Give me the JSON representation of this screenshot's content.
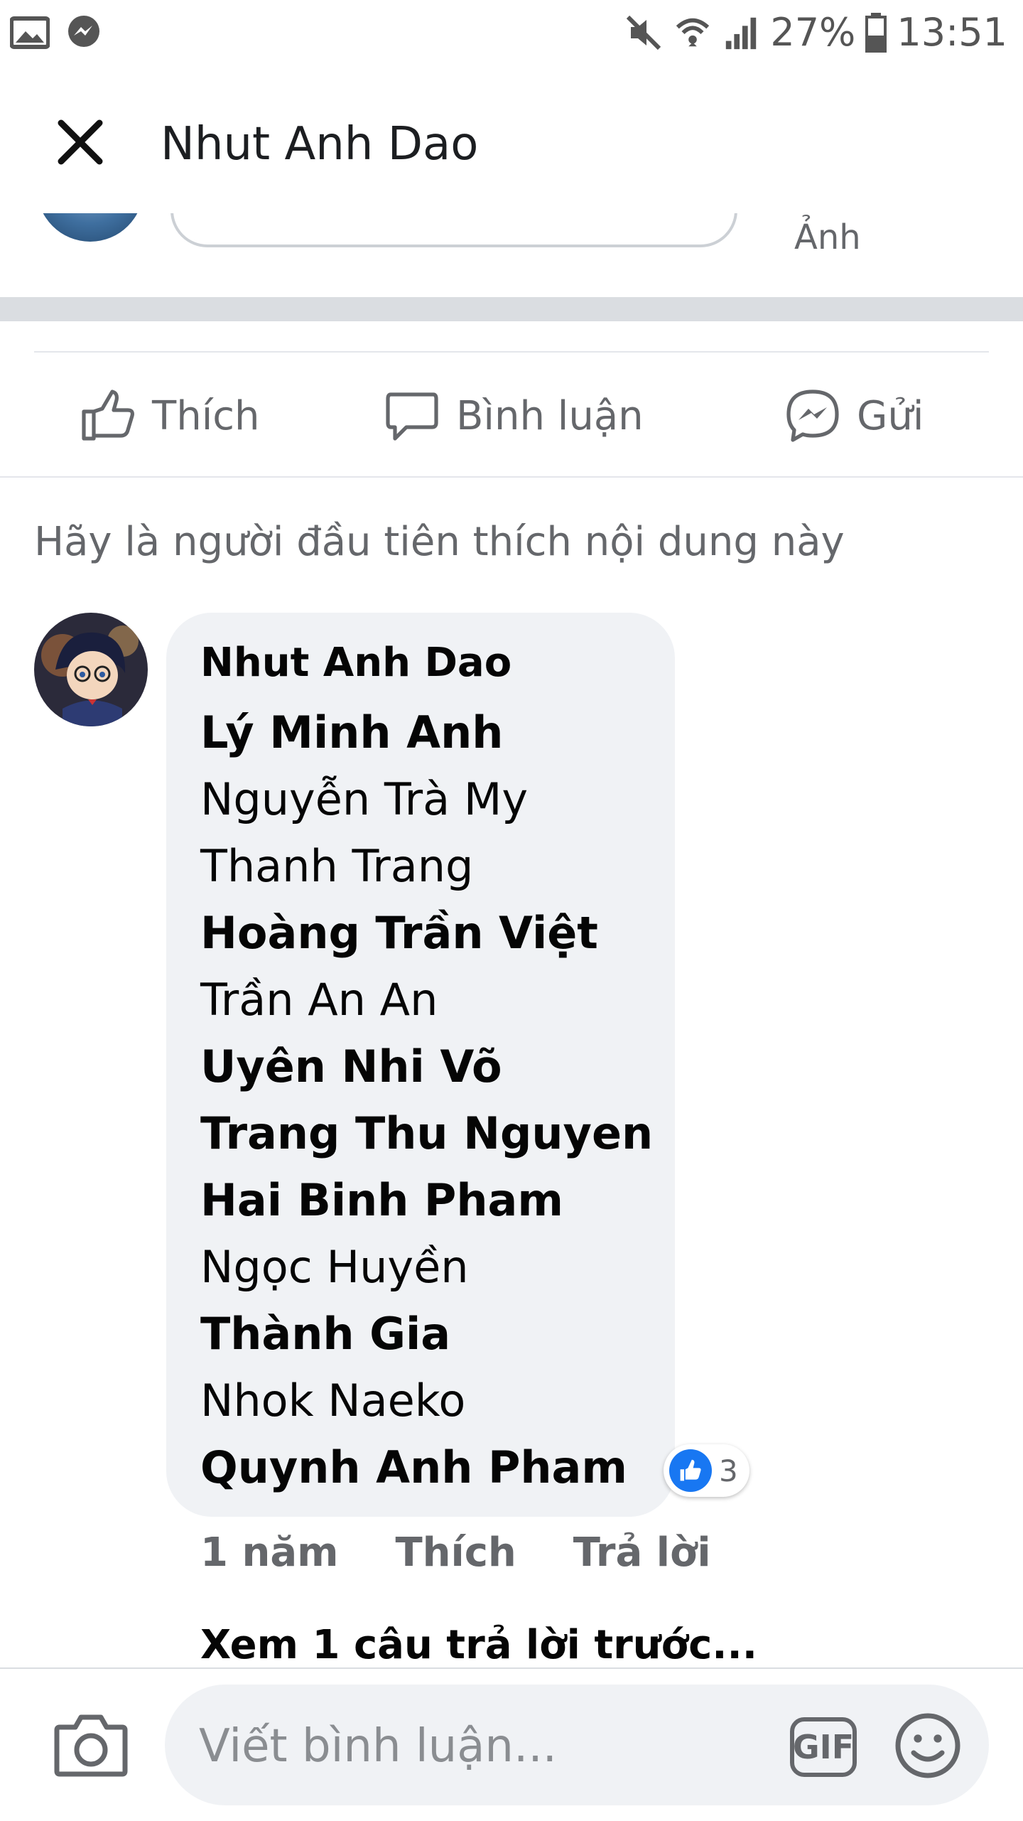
{
  "status_bar": {
    "battery": "27%",
    "time": "13:51",
    "icons": [
      "image-icon",
      "messenger-icon",
      "mute-icon",
      "wifi-icon",
      "signal-icon",
      "battery-icon"
    ]
  },
  "header": {
    "title": "Nhut Anh Dao",
    "close_icon": "close-icon"
  },
  "previous_post": {
    "photo_label": "Ảnh"
  },
  "actions": {
    "like": "Thích",
    "comment": "Bình luận",
    "send": "Gửi"
  },
  "reactions_note": "Hãy là người đầu tiên thích nội dung này",
  "comment": {
    "author": "Nhut Anh Dao",
    "lines": [
      {
        "text": "Lý Minh Anh",
        "bold": true
      },
      {
        "text": "Nguyễn Trà My",
        "bold": false
      },
      {
        "text": "Thanh Trang",
        "bold": false
      },
      {
        "text": "Hoàng Trần Việt",
        "bold": true
      },
      {
        "text": "Trần An An",
        "bold": false
      },
      {
        "text": "Uyên Nhi Võ",
        "bold": true
      },
      {
        "text": "Trang Thu Nguyen",
        "bold": true
      },
      {
        "text": "Hai Binh Pham",
        "bold": true
      },
      {
        "text": "Ngọc Huyền",
        "bold": false
      },
      {
        "text": "Thành Gia",
        "bold": true
      },
      {
        "text": "Nhok Naeko",
        "bold": false
      },
      {
        "text": "Quynh Anh Pham",
        "bold": true
      }
    ],
    "reaction_count": "3",
    "time": "1 năm",
    "like_label": "Thích",
    "reply_label": "Trả lời"
  },
  "more_replies": "Xem 1 câu trả lời trước...",
  "composer": {
    "placeholder": "Viết bình luận...",
    "gif_label": "GIF"
  },
  "colors": {
    "accent": "#1877f2",
    "bubble": "#f0f2f5",
    "secondary_text": "#65676b"
  }
}
